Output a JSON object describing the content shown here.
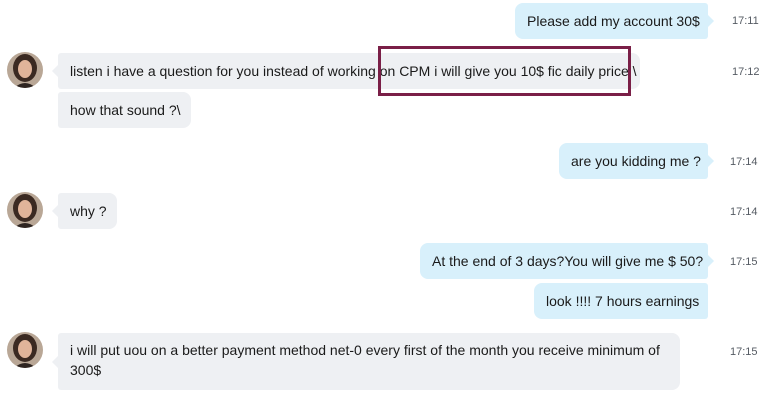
{
  "messages": [
    {
      "direction": "outgoing",
      "text": "Please add my account 30$",
      "time": "17:11"
    },
    {
      "direction": "incoming",
      "text": "listen i have a question for you instead of working on CPM i will give you 10$ fic daily price \\",
      "time": "17:12"
    },
    {
      "direction": "incoming",
      "text": "how that sound ?\\",
      "time": ""
    },
    {
      "direction": "outgoing",
      "text": "are you kidding me ?",
      "time": "17:14"
    },
    {
      "direction": "incoming",
      "text": "why ?",
      "time": "17:14"
    },
    {
      "direction": "outgoing",
      "text": "At the end of 3 days?You will give me $ 50?",
      "time": "17:15"
    },
    {
      "direction": "outgoing",
      "text": "look !!!! 7 hours earnings",
      "time": ""
    },
    {
      "direction": "incoming",
      "text": "i will put uou on a better payment method net-0 every first of the month you receive minimum of 300$",
      "time": "17:15"
    }
  ],
  "colors": {
    "incoming_bubble": "#eef0f3",
    "outgoing_bubble": "#d8f0fb",
    "highlight_border": "#7a1f47"
  },
  "avatar_icon": "contact-avatar"
}
